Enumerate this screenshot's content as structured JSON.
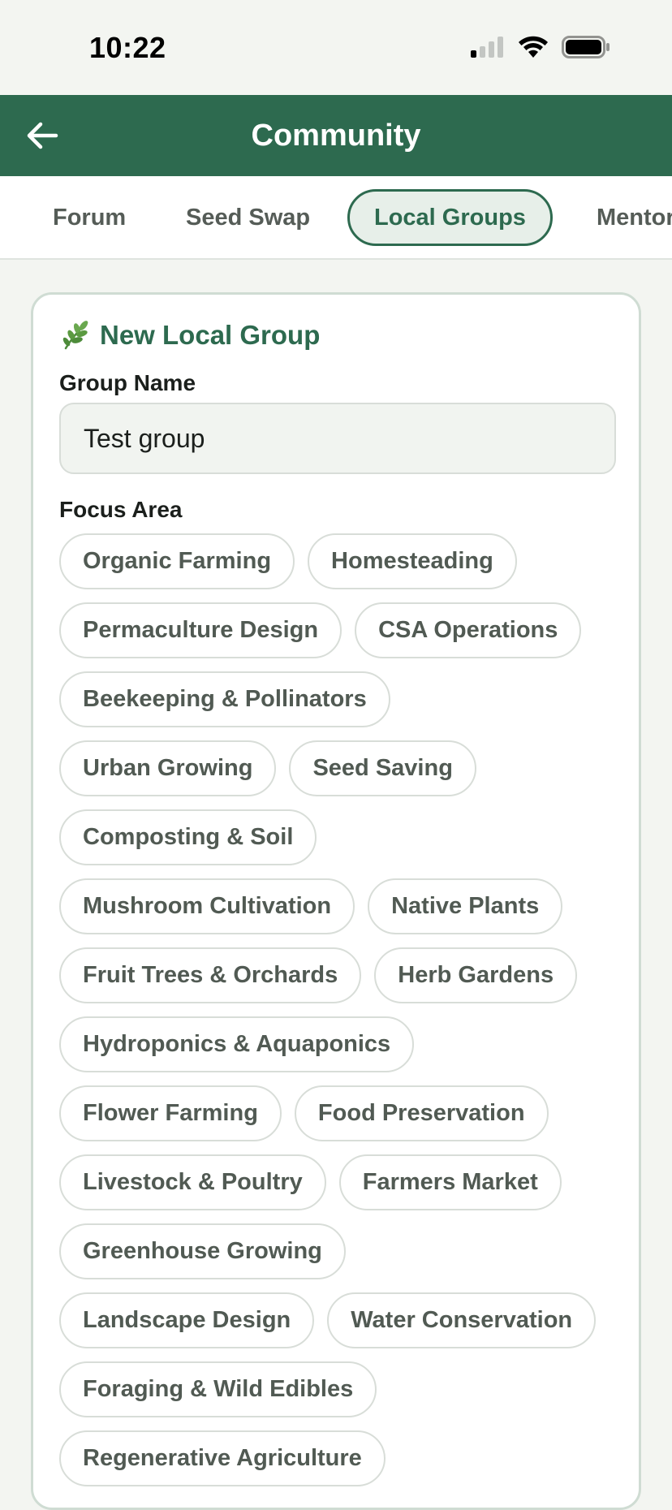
{
  "status_bar": {
    "time": "10:22"
  },
  "app_bar": {
    "title": "Community"
  },
  "tabs": [
    {
      "label": "Forum"
    },
    {
      "label": "Seed Swap"
    },
    {
      "label": "Local Groups",
      "active": true
    },
    {
      "label": "Mentor"
    }
  ],
  "form": {
    "title": "New Local Group",
    "group_name_label": "Group Name",
    "group_name_value": "Test group",
    "focus_area_label": "Focus Area",
    "focus_areas": [
      [
        "Organic Farming",
        "Homesteading"
      ],
      [
        "Permaculture Design",
        "CSA Operations"
      ],
      [
        "Beekeeping & Pollinators"
      ],
      [
        "Urban Growing",
        "Seed Saving"
      ],
      [
        "Composting & Soil"
      ],
      [
        "Mushroom Cultivation",
        "Native Plants"
      ],
      [
        "Fruit Trees & Orchards",
        "Herb Gardens"
      ],
      [
        "Hydroponics & Aquaponics"
      ],
      [
        "Flower Farming",
        "Food Preservation"
      ],
      [
        "Livestock & Poultry",
        "Farmers Market"
      ],
      [
        "Greenhouse Growing"
      ],
      [
        "Landscape Design",
        "Water Conservation"
      ],
      [
        "Foraging & Wild Edibles"
      ],
      [
        "Regenerative Agriculture"
      ]
    ]
  },
  "icons": {
    "back": "arrow-left-icon",
    "title_icon": "leaf-sprig-icon",
    "signal": "cellular-signal-icon",
    "wifi": "wifi-icon",
    "battery": "battery-icon"
  },
  "colors": {
    "primary": "#2d6a4f",
    "background": "#f3f5f1",
    "chip_border": "#d8ddd8",
    "chip_text": "#515a53"
  }
}
